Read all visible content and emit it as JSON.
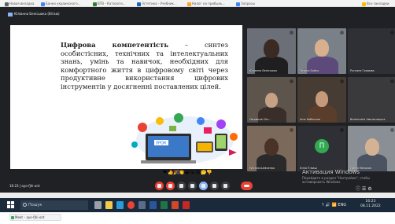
{
  "bookmarks": [
    {
      "label": "Новая вкладка",
      "color": "#5f6368"
    },
    {
      "label": "Банки украинскoго...",
      "color": "#4285f4"
    },
    {
      "label": "ВТВ - Каталоги...",
      "color": "#2e7d32"
    },
    {
      "label": "Эстетика - Учебник...",
      "color": "#1565c0"
    },
    {
      "label": "Налог на прибыль...",
      "color": "#f9a825"
    },
    {
      "label": "Запросы",
      "color": "#4285f4"
    },
    {
      "label": "Все закладки",
      "color": "#fbbc04"
    }
  ],
  "meet": {
    "presenter_label": "Юлiанна Бенiсьюка (Вiтаю)",
    "time_code": "16:23  |  ayo-fjhi-ont",
    "activate": {
      "line1": "Активация Windows",
      "line2": "Перейдите в раздел \"Настройки\", чтобы",
      "line3": "активировать Windows."
    },
    "right_controls": "ⓘ  ☰  ⚙"
  },
  "slide": {
    "term": "Цифрова компетентість",
    "definition": " – синтез особистісних, технічних та інтелектуальних знань, умінь та навичок, необхідних для комфортного життя в цифровому світі через продуктивне використання цифрових інструментів у досягненні поставлених цілей.",
    "cloud_label": "УРОК"
  },
  "reactions": [
    "❤",
    "👍",
    "🎉",
    "👏",
    "😂",
    "😮",
    "😢",
    "🤔",
    "👎"
  ],
  "participants": [
    {
      "name": "Юлiанна Бенiсьюка",
      "bg": "#6b6f78",
      "head": "#3a2a22",
      "body": "#1f1f1f"
    },
    {
      "name": "Тетяна Бойко",
      "bg": "#7a8087",
      "head": "#d8b090",
      "body": "#5c4b7a"
    },
    {
      "name": "Руслана Громова",
      "bg": "#2e3035",
      "head": "",
      "body": ""
    },
    {
      "name": "Людмила Сiм...",
      "bg": "#5d544c",
      "head": "#c7a185",
      "body": "#3a2e2a"
    },
    {
      "name": "Інна Бабiнська",
      "bg": "#463c33",
      "head": "#c49a7a",
      "body": "#5a3d2b"
    },
    {
      "name": "Валентина Хмельницька",
      "bg": "#3a3a3c",
      "head": "",
      "body": ""
    },
    {
      "name": "Наталя Шевченко",
      "bg": "#7b6a5c",
      "head": "#4a3228",
      "body": "#2a2a2a"
    },
    {
      "name": "Юлiя П Іваш",
      "bg": "#2e3035",
      "avatar": "П",
      "avatar_color": "#33a852"
    },
    {
      "name": "Ганна Мельник",
      "bg": "#8a8f95",
      "head": "#d5b294",
      "body": "#4b5260"
    }
  ],
  "taskbar": {
    "search_placeholder": "Пошук",
    "tray": "↑  🔊  📶  ENG",
    "time": "16:23",
    "date": "08.11.2022",
    "apps": [
      {
        "name": "task-view",
        "color": "#9aa0a6"
      },
      {
        "name": "file-explorer",
        "color": "#f2c94c"
      },
      {
        "name": "edge",
        "color": "#2a9bd8"
      },
      {
        "name": "chrome",
        "color": "#ea4335"
      },
      {
        "name": "store",
        "color": "#5b6b8a"
      },
      {
        "name": "word",
        "color": "#2b579a"
      },
      {
        "name": "excel",
        "color": "#217346"
      },
      {
        "name": "powerpoint",
        "color": "#d24726"
      },
      {
        "name": "pdf",
        "color": "#c62828"
      }
    ]
  },
  "bottom_tab": {
    "label": "Meet – ayo-fjhi-ont"
  }
}
